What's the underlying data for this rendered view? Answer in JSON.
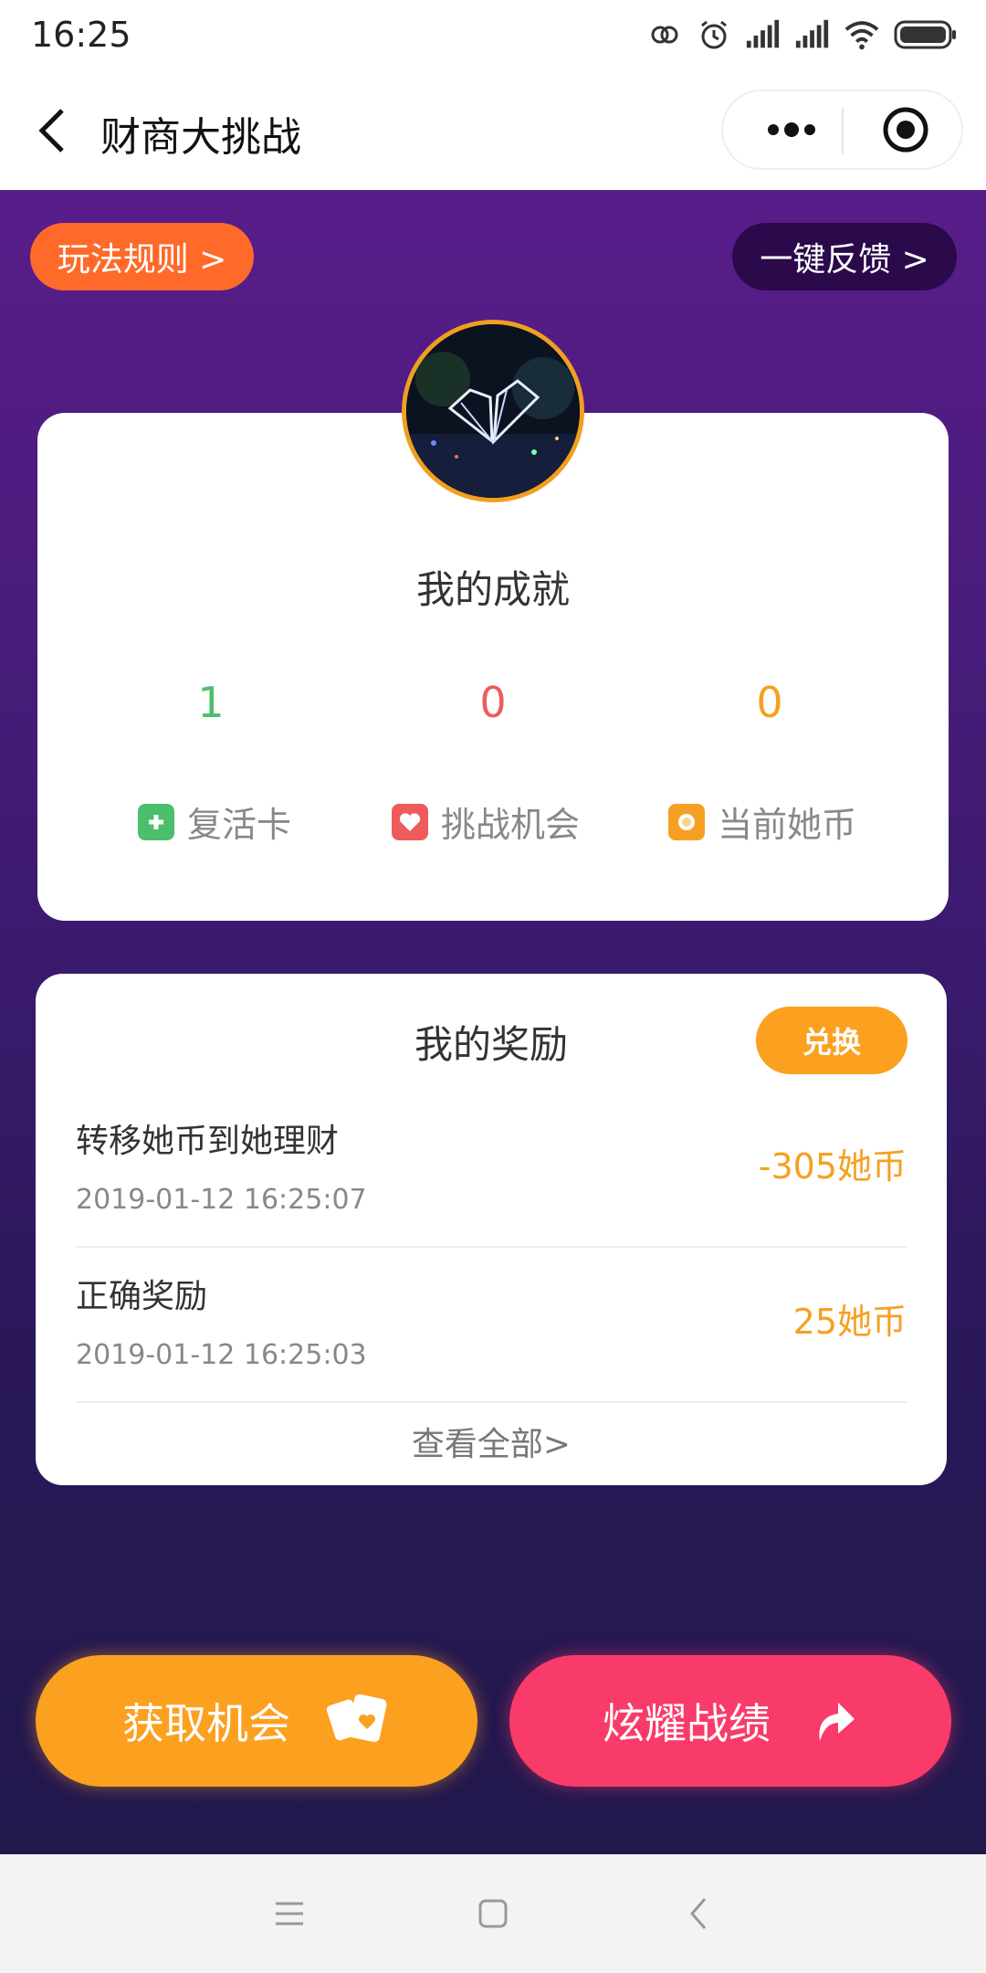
{
  "status_bar": {
    "time": "16:25"
  },
  "nav": {
    "title": "财商大挑战"
  },
  "top_buttons": {
    "rules": "玩法规则 >",
    "feedback": "一键反馈 >"
  },
  "achievement": {
    "title": "我的成就",
    "stats": [
      {
        "value": "1",
        "label": "复活卡",
        "color": "#4cbf6c"
      },
      {
        "value": "0",
        "label": "挑战机会",
        "color": "#ef5b5b"
      },
      {
        "value": "0",
        "label": "当前她币",
        "color": "#f5a023"
      }
    ]
  },
  "rewards": {
    "title": "我的奖励",
    "exchange_label": "兑换",
    "items": [
      {
        "name": "转移她币到她理财",
        "time": "2019-01-12 16:25:07",
        "amount": "-305她币"
      },
      {
        "name": "正确奖励",
        "time": "2019-01-12 16:25:03",
        "amount": "25她币"
      }
    ],
    "view_all": "查看全部>"
  },
  "actions": {
    "get_chance": "获取机会",
    "show_off": "炫耀战绩"
  },
  "colors": {
    "purple_top": "#591d8a",
    "purple_bottom": "#22184c",
    "orange": "#fca020",
    "pink": "#f93b6a",
    "rules_orange": "#ff6a2a"
  }
}
